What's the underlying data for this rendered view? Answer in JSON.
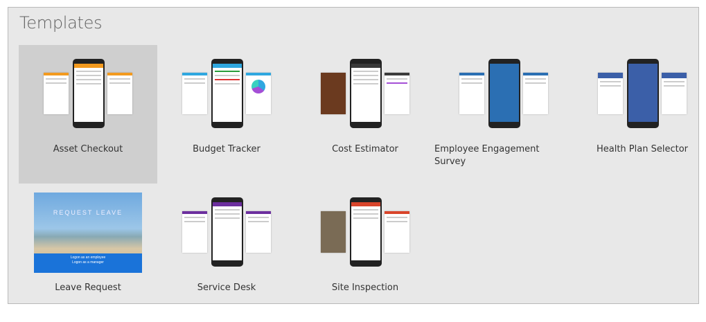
{
  "section_title": "Templates",
  "templates": [
    {
      "label": "Asset Checkout",
      "accent": "#f39a1e"
    },
    {
      "label": "Budget Tracker",
      "accent": "#2fa7e0"
    },
    {
      "label": "Cost Estimator",
      "accent": "#3a3a3a"
    },
    {
      "label": "Employee Engagement Survey",
      "accent": "#2b6fb3"
    },
    {
      "label": "Health Plan Selector",
      "accent": "#3b5fa8"
    },
    {
      "label": "Leave Request",
      "accent": "#1a73d9"
    },
    {
      "label": "Service Desk",
      "accent": "#6c2f9e"
    },
    {
      "label": "Site Inspection",
      "accent": "#d9452b"
    }
  ],
  "leave_thumb": {
    "banner": "REQUEST LEAVE",
    "line1": "Logon as an employee",
    "line2": "Logon as a manager"
  }
}
